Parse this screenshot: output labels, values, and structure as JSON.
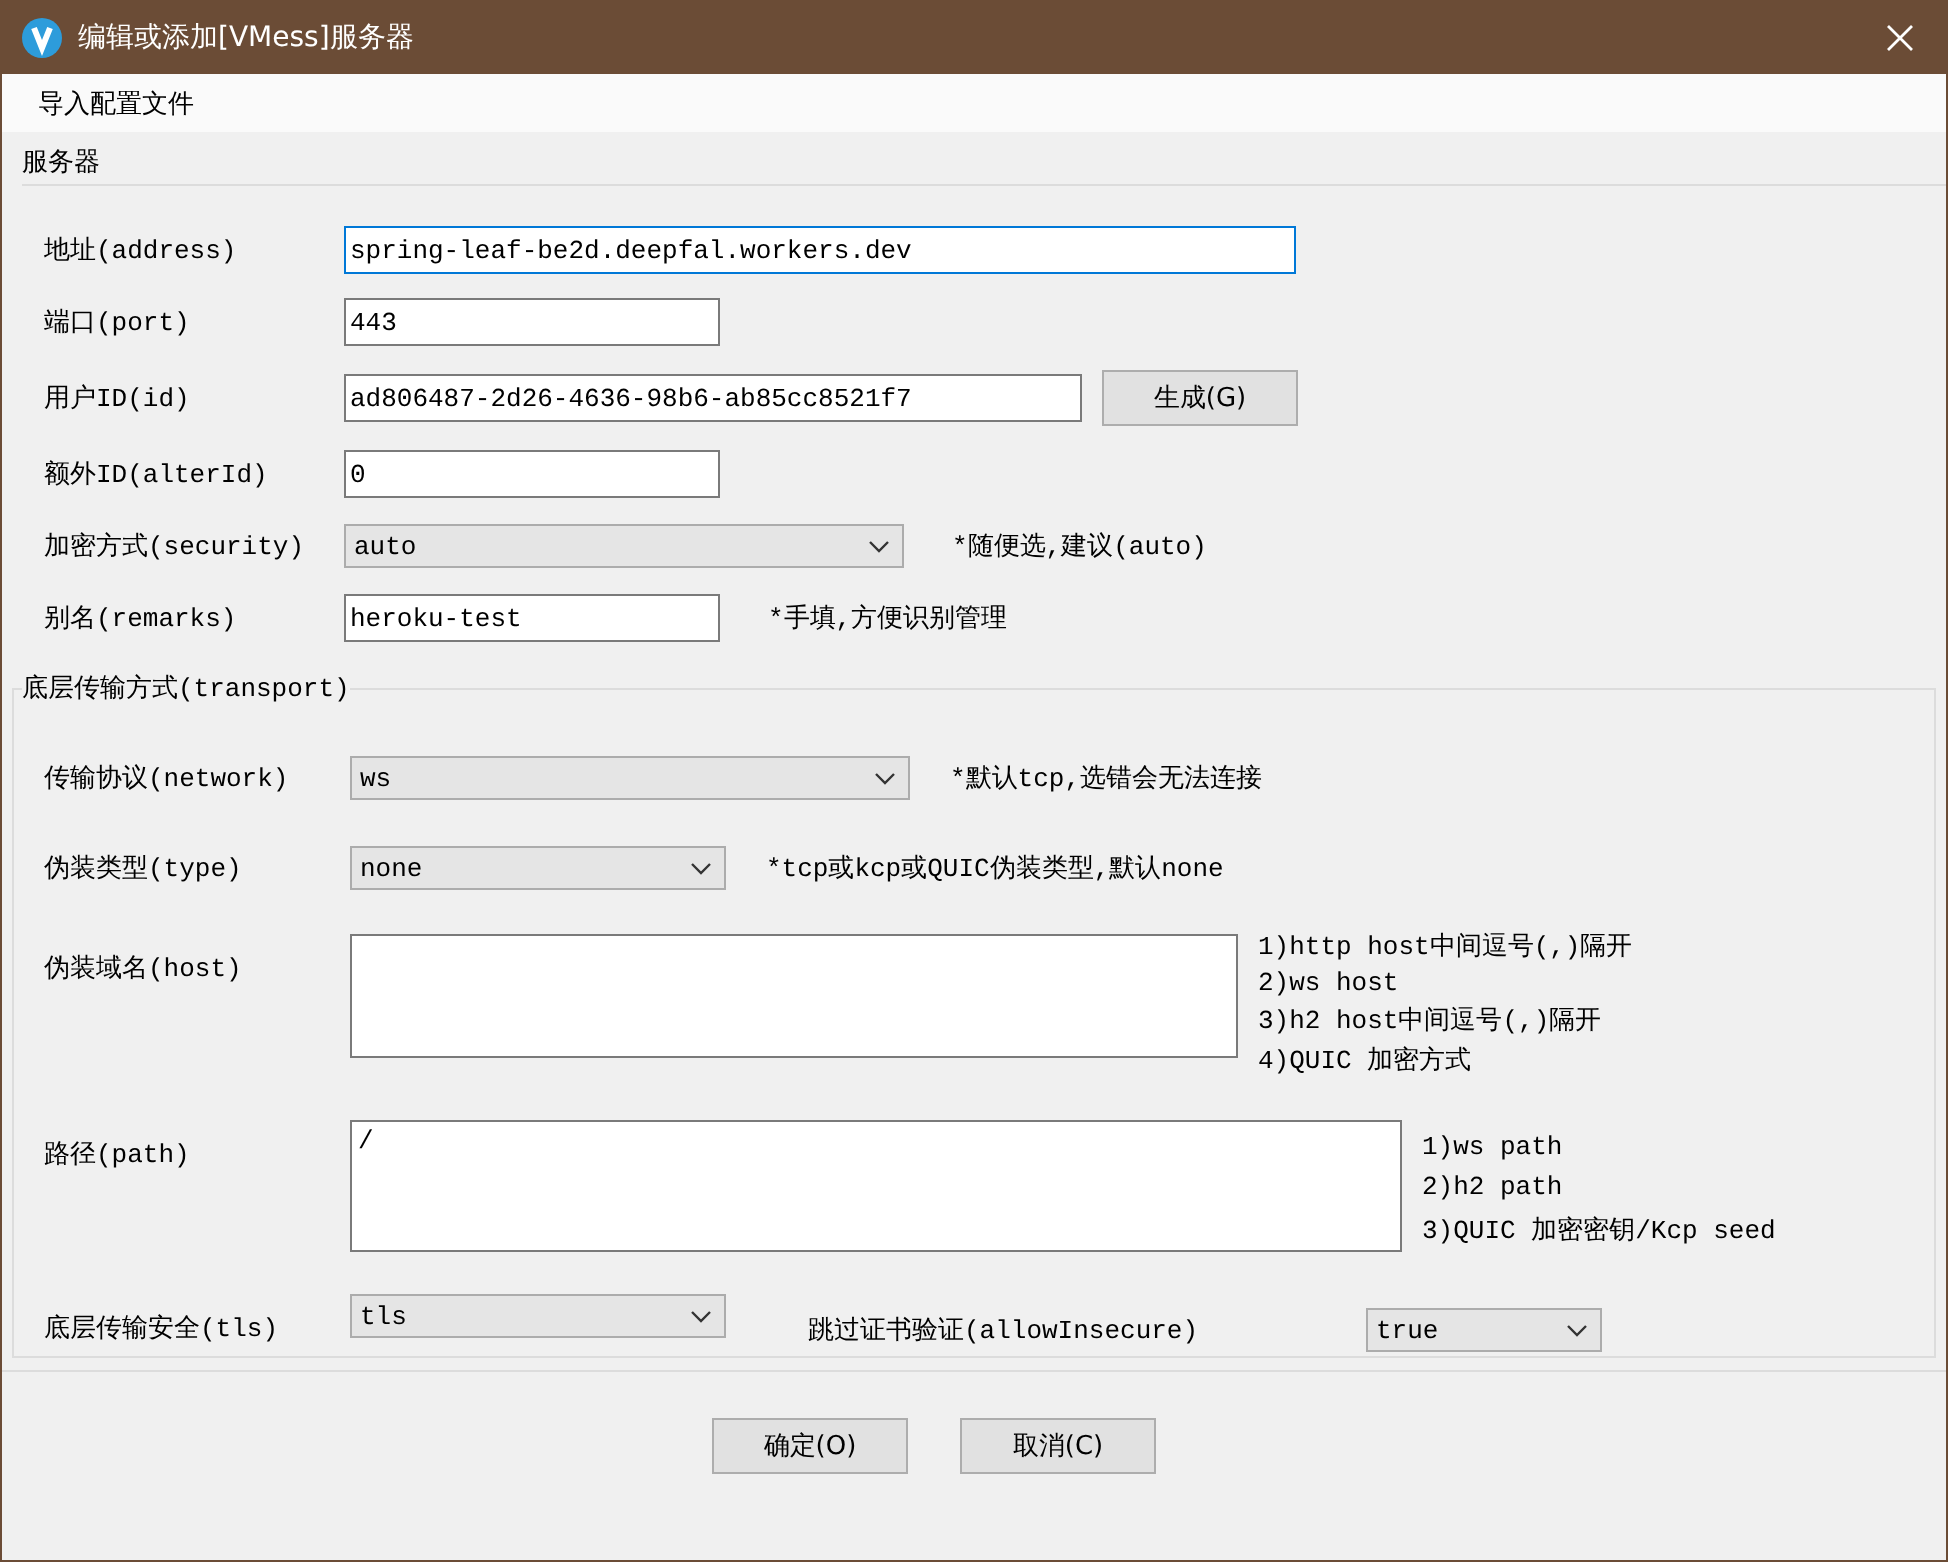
{
  "window": {
    "title": "编辑或添加[VMess]服务器"
  },
  "menu": [
    {
      "label": "导入配置文件"
    }
  ],
  "server_group": {
    "title": "服务器",
    "fields": [
      {
        "kind": "text",
        "label": "地址(address)",
        "value": "spring-leaf-be2d.deepfal.workers.dev",
        "focused": true
      },
      {
        "kind": "text",
        "label": "端口(port)",
        "value": "443",
        "focused": false
      },
      {
        "kind": "text",
        "label": "用户ID(id)",
        "value": "ad806487-2d26-4636-98b6-ab85cc8521f7",
        "focused": false,
        "button": "生成(G)"
      },
      {
        "kind": "text",
        "label": "额外ID(alterId)",
        "value": "0",
        "focused": false
      },
      {
        "kind": "select",
        "label": "加密方式(security)",
        "value": "auto",
        "note": "*随便选,建议(auto)"
      },
      {
        "kind": "text",
        "label": "别名(remarks)",
        "value": "heroku-test",
        "focused": false,
        "note": "*手填,方便识别管理"
      }
    ]
  },
  "transport_group": {
    "title": "底层传输方式(transport)",
    "fields": [
      {
        "kind": "select",
        "label": "传输协议(network)",
        "value": "ws",
        "note": "*默认tcp,选错会无法连接"
      },
      {
        "kind": "select",
        "label": "伪装类型(type)",
        "value": "none",
        "note": "*tcp或kcp或QUIC伪装类型,默认none"
      },
      {
        "kind": "textarea",
        "label": "伪装域名(host)",
        "notes": [
          "1)http host中间逗号(,)隔开",
          "2)ws host",
          "3)h2 host中间逗号(,)隔开",
          "4)QUIC 加密方式"
        ]
      },
      {
        "kind": "textarea",
        "label": "路径(path)",
        "value": "/",
        "notes": [
          "1)ws path",
          "2)h2 path",
          "3)QUIC 加密密钥/Kcp seed"
        ]
      },
      {
        "kind": "select",
        "label": "底层传输安全(tls)",
        "value": "tls",
        "extra": {
          "label": "跳过证书验证(allowInsecure)",
          "value": "true"
        }
      }
    ]
  },
  "buttons": [
    {
      "label": "确定(O)"
    },
    {
      "label": "取消(C)"
    }
  ]
}
